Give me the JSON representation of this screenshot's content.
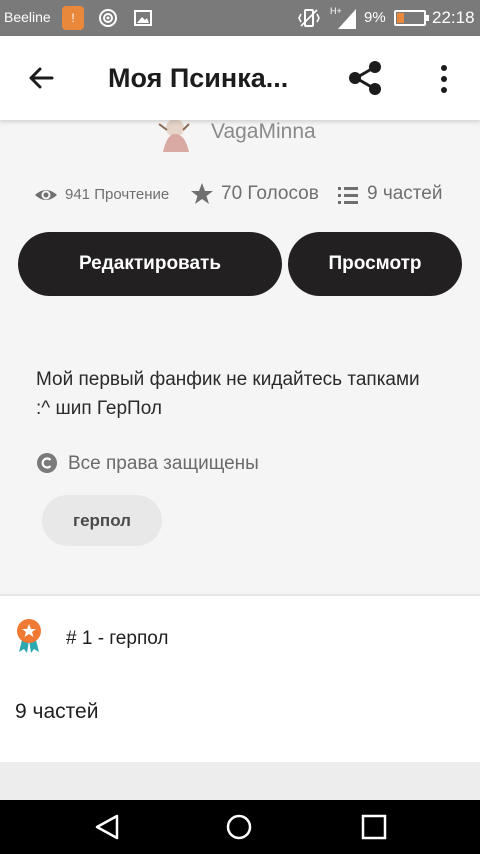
{
  "status_bar": {
    "carrier": "Beeline",
    "battery_percent_text": "9%",
    "battery_level": 0.09,
    "time": "22:18",
    "signal_label": "H+",
    "notification_badge": "!"
  },
  "app_bar": {
    "title": "Моя Псинка...",
    "back_icon": "arrow-left-icon",
    "share_icon": "share-icon",
    "more_icon": "more-vertical-icon"
  },
  "story": {
    "author": "VagaMinna",
    "stats": {
      "reads": "941 Прочтение",
      "votes": "70 Голосов",
      "parts": "9 частей"
    },
    "buttons": {
      "edit": "Редактировать",
      "preview": "Просмотр"
    },
    "description": "Мой первый фанфик не кидайтесь тапками :^ шип ГерПол",
    "copyright": "Все права защищены",
    "tags": [
      "герпол"
    ]
  },
  "ranking": {
    "text": "# 1 - герпол",
    "parts_heading": "9 частей"
  },
  "colors": {
    "button_bg": "#232021",
    "accent_orange": "#f07a33",
    "status_bar_bg": "#7a7a7a"
  }
}
